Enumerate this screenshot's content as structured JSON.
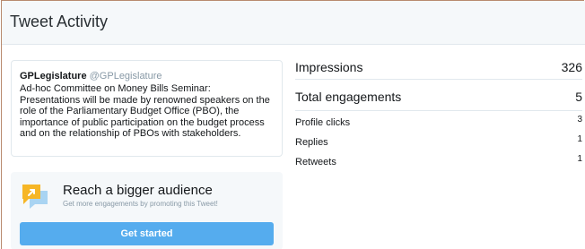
{
  "header": {
    "title": "Tweet Activity"
  },
  "tweet": {
    "author_name": "GPLegislature",
    "author_handle": "@GPLegislature",
    "text": "Ad-hoc Committee on Money Bills Seminar: Presentations will be made by renowned speakers on the role of the Parliamentary Budget Office (PBO), the importance of public participation on the budget process and on the relationship of PBOs with stakeholders."
  },
  "promo": {
    "icon": "megaphone-chat-icon",
    "title": "Reach a bigger audience",
    "subtitle": "Get more engagements by promoting this Tweet!",
    "button_label": "Get started",
    "accent_color": "#55acee",
    "icon_color": "#f6b626"
  },
  "stats": {
    "impressions": {
      "label": "Impressions",
      "value": "326"
    },
    "total_engagements": {
      "label": "Total engagements",
      "value": "5"
    },
    "breakdown": [
      {
        "label": "Profile clicks",
        "value": "3"
      },
      {
        "label": "Replies",
        "value": "1"
      },
      {
        "label": "Retweets",
        "value": "1"
      }
    ]
  }
}
